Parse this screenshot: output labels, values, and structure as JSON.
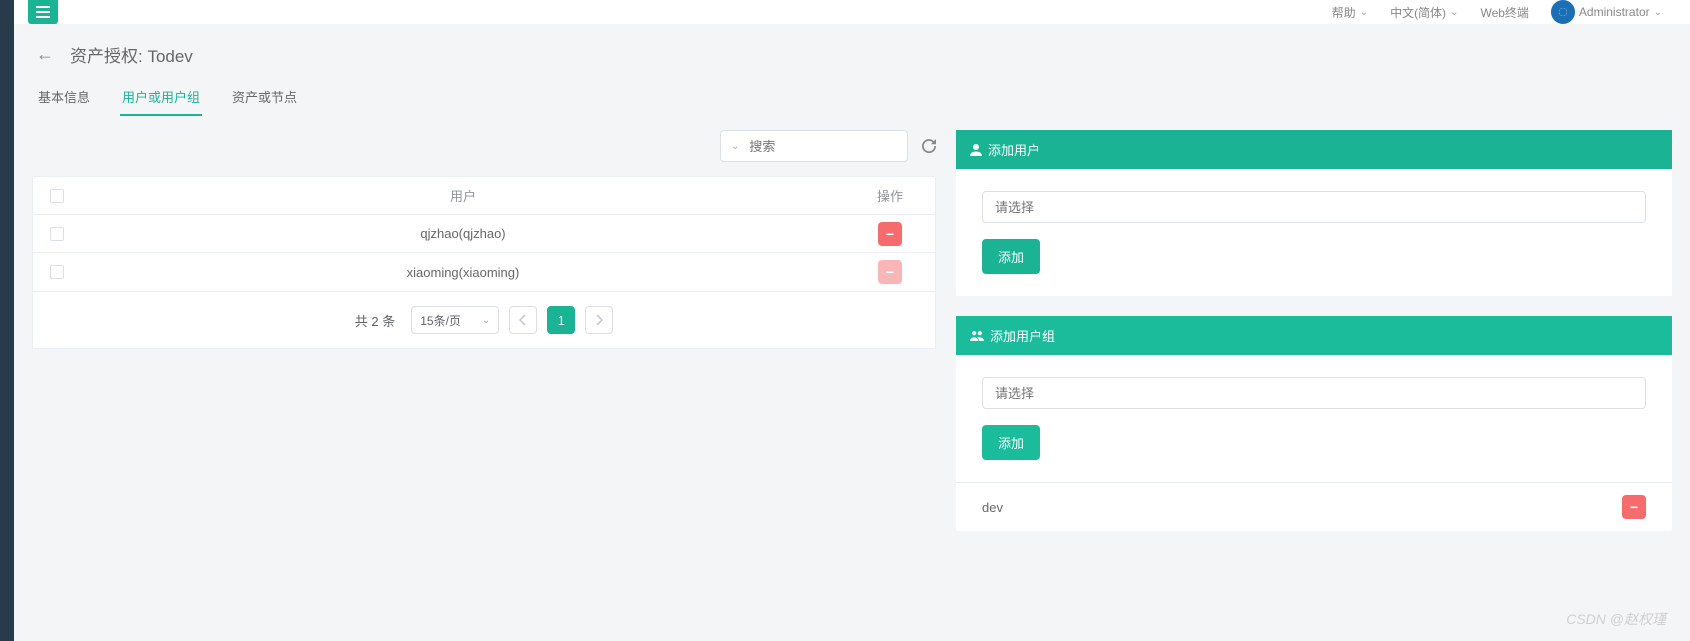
{
  "topbar": {
    "help": "帮助",
    "lang": "中文(简体)",
    "webterm": "Web终端",
    "user": "Administrator"
  },
  "page": {
    "title": "资产授权: Todev"
  },
  "tabs": {
    "basic": "基本信息",
    "users": "用户或用户组",
    "assets": "资产或节点"
  },
  "search": {
    "placeholder": "搜索"
  },
  "table": {
    "col_user": "用户",
    "col_op": "操作",
    "rows": [
      {
        "user": "qjzhao(qjzhao)",
        "faded": false
      },
      {
        "user": "xiaoming(xiaoming)",
        "faded": true
      }
    ]
  },
  "pager": {
    "total": "共 2 条",
    "size": "15条/页",
    "current": "1"
  },
  "panel_user": {
    "title": "添加用户",
    "placeholder": "请选择",
    "btn": "添加"
  },
  "panel_group": {
    "title": "添加用户组",
    "placeholder": "请选择",
    "btn": "添加",
    "items": [
      "dev"
    ]
  },
  "watermark": "CSDN @赵权瑾"
}
